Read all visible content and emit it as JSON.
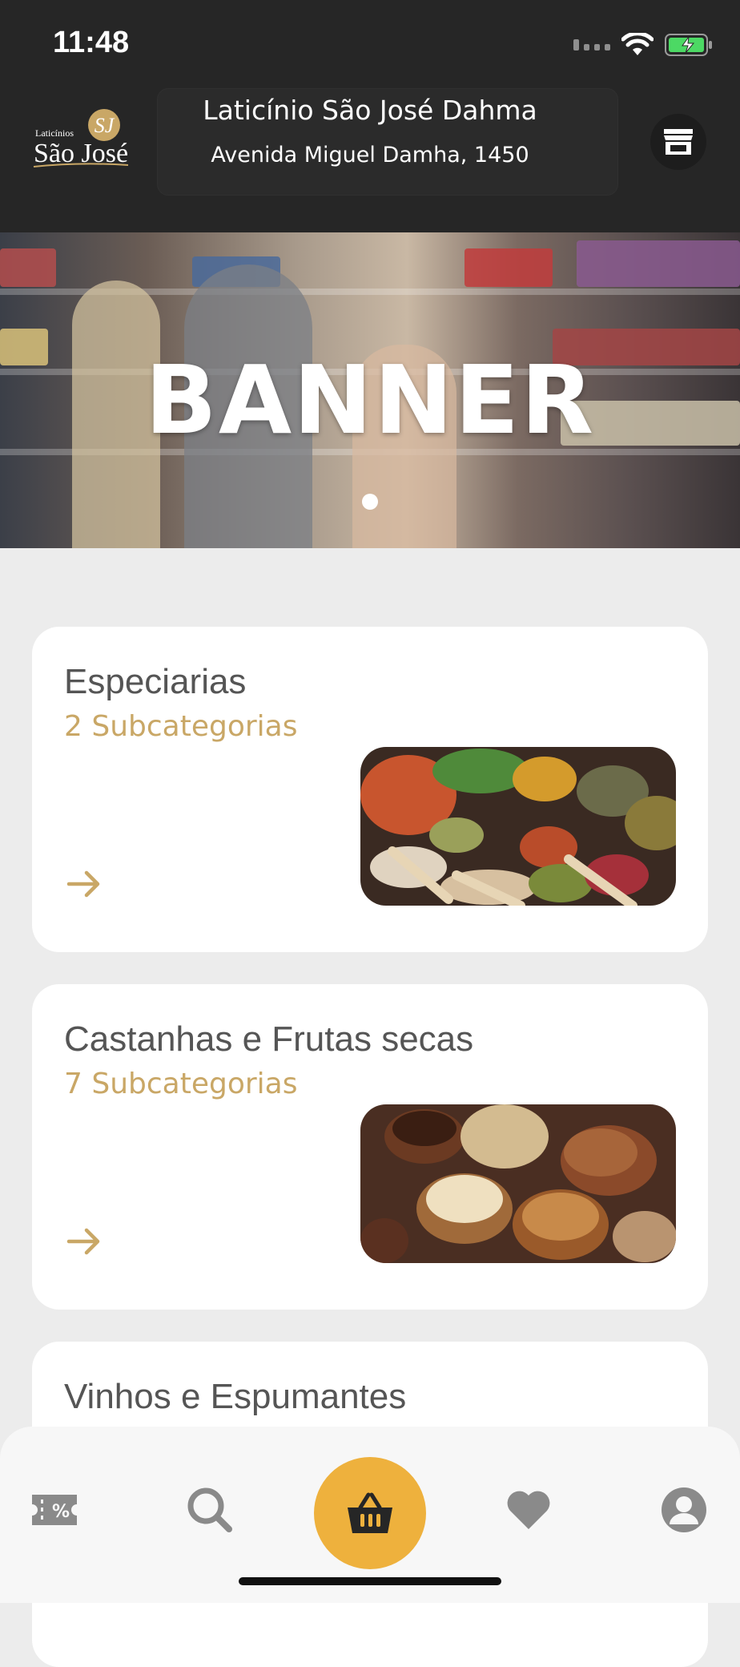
{
  "status": {
    "time": "11:48"
  },
  "header": {
    "logo_text_small": "Laticínios",
    "logo_text_big": "São José",
    "logo_monogram": "SJ",
    "store_name": "Laticínio São José Dahma",
    "store_address": "Avenida Miguel Damha, 1450"
  },
  "banner": {
    "title": "BANNER"
  },
  "categories": [
    {
      "title": "Especiarias",
      "subtitle": "2 Subcategorias"
    },
    {
      "title": "Castanhas e Frutas secas",
      "subtitle": "7 Subcategorias"
    },
    {
      "title": "Vinhos e Espumantes",
      "subtitle": ""
    }
  ],
  "tabs": [
    {
      "icon": "coupon-icon"
    },
    {
      "icon": "search-icon"
    },
    {
      "icon": "basket-icon"
    },
    {
      "icon": "heart-icon"
    },
    {
      "icon": "profile-icon"
    }
  ],
  "colors": {
    "header_bg": "#262626",
    "accent": "#eeb13d",
    "subtitle": "#c9a766",
    "background": "#ececec"
  }
}
